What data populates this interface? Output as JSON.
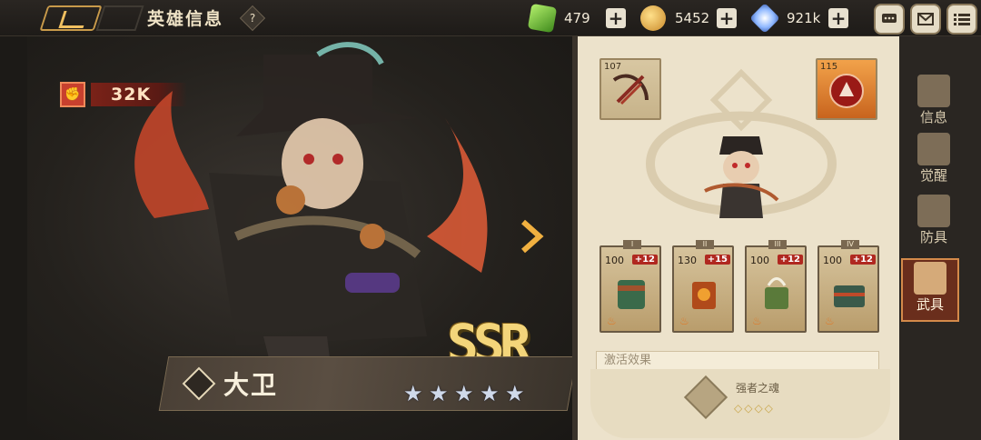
{
  "header": {
    "page_title": "英雄信息",
    "help_label": "?",
    "currencies": [
      {
        "name": "green-gem",
        "value": "479",
        "plus": "+"
      },
      {
        "name": "gold-coin",
        "value": "5452",
        "plus": "+"
      },
      {
        "name": "crystal",
        "value": "921k",
        "plus": "+"
      }
    ],
    "menu_icons": [
      "chat-icon",
      "mail-icon",
      "list-menu-icon"
    ]
  },
  "hero": {
    "power": "32K",
    "rarity": "SSR",
    "name": "大卫",
    "stars": 5
  },
  "equipment": {
    "weapon_level": "107",
    "skill_level": "115",
    "gear": [
      {
        "tier": "I",
        "level": "100",
        "plus": "+12"
      },
      {
        "tier": "II",
        "level": "130",
        "plus": "+15"
      },
      {
        "tier": "III",
        "level": "100",
        "plus": "+12"
      },
      {
        "tier": "IV",
        "level": "100",
        "plus": "+12"
      }
    ],
    "effect_label": "激活效果",
    "effect_name": "强者之魂",
    "effect_pips": "◇◇◇◇"
  },
  "tabs": [
    {
      "id": "info",
      "label": "信息"
    },
    {
      "id": "awaken",
      "label": "觉醒"
    },
    {
      "id": "armor",
      "label": "防具"
    },
    {
      "id": "weapon",
      "label": "武具"
    }
  ],
  "colors": {
    "accent_gold": "#f3d57a",
    "panel_bg": "#ece2cb",
    "active_tab": "#6a2e1c",
    "plus_badge": "#b02820"
  }
}
